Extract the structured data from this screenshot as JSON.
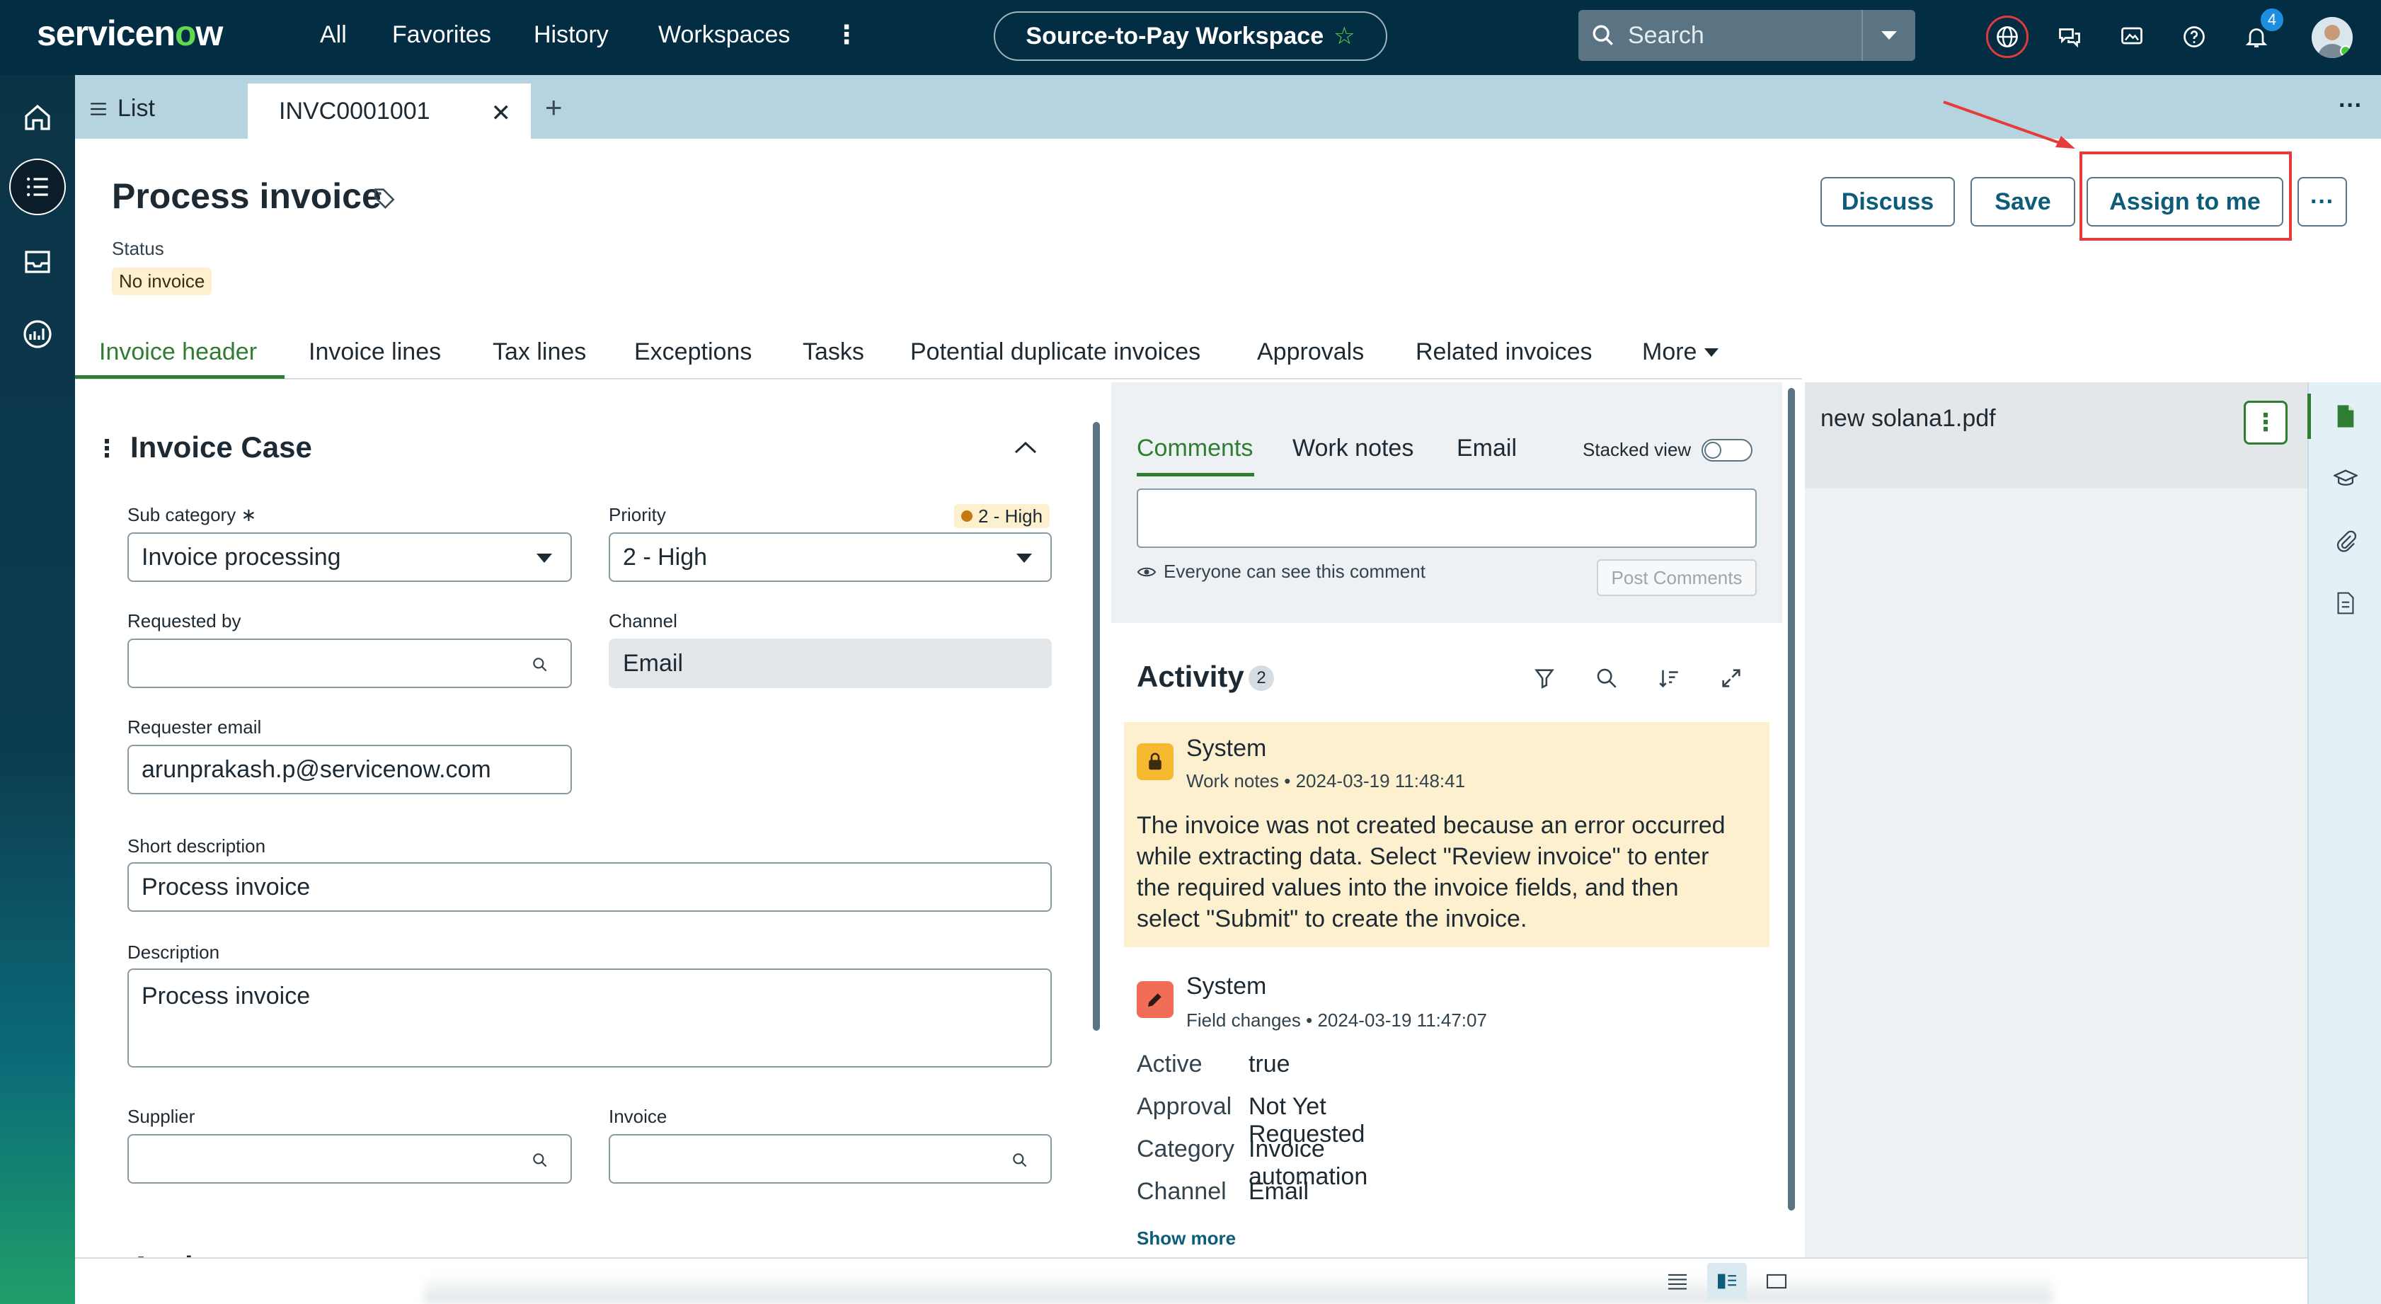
{
  "topnav": {
    "logo": "servicenow",
    "links": [
      "All",
      "Favorites",
      "History",
      "Workspaces"
    ],
    "workspace_name": "Source-to-Pay Workspace",
    "search_placeholder": "Search",
    "notification_count": "4"
  },
  "tabs": {
    "list_label": "List",
    "record_tab_label": "INVC0001001"
  },
  "header": {
    "title": "Process invoice",
    "status_label": "Status",
    "status_value": "No invoice",
    "buttons": {
      "discuss": "Discuss",
      "save": "Save",
      "assign_to_me": "Assign to me",
      "more": "···"
    },
    "highlight_color": "#e63b3b"
  },
  "record_tabs": [
    "Invoice header",
    "Invoice lines",
    "Tax lines",
    "Exceptions",
    "Tasks",
    "Potential duplicate invoices",
    "Approvals",
    "Related invoices",
    "More"
  ],
  "form": {
    "section_title": "Invoice Case",
    "sub_category": {
      "label": "Sub category",
      "required_mark": "∗",
      "value": "Invoice processing"
    },
    "priority": {
      "label": "Priority",
      "chip": "2 - High",
      "value": "2 - High"
    },
    "requested_by": {
      "label": "Requested by",
      "value": ""
    },
    "channel": {
      "label": "Channel",
      "value": "Email"
    },
    "requester_email": {
      "label": "Requester email",
      "value": "arunprakash.p@servicenow.com"
    },
    "short_description": {
      "label": "Short description",
      "value": "Process invoice"
    },
    "description": {
      "label": "Description",
      "value": "Process invoice"
    },
    "supplier": {
      "label": "Supplier",
      "value": ""
    },
    "invoice": {
      "label": "Invoice",
      "value": ""
    },
    "next_section_partial": "Assignment"
  },
  "activity": {
    "tabs": [
      "Comments",
      "Work notes",
      "Email"
    ],
    "stacked_view_label": "Stacked view",
    "visibility_note": "Everyone can see this comment",
    "post_button": "Post Comments",
    "title": "Activity",
    "count": "2",
    "entries": [
      {
        "author": "System",
        "type": "Work notes",
        "timestamp": "2024-03-19 11:48:41",
        "lines": [
          "The invoice was not created because an error occurred",
          "while extracting data. Select \"Review invoice\" to enter",
          "the required values into the invoice fields, and then",
          "select \"Submit\" to create the invoice."
        ]
      },
      {
        "author": "System",
        "type": "Field changes",
        "timestamp": "2024-03-19 11:47:07",
        "changes": [
          {
            "key": "Active",
            "value": "true"
          },
          {
            "key": "Approval",
            "value": "Not Yet Requested"
          },
          {
            "key": "Category",
            "value": "Invoice automation"
          },
          {
            "key": "Channel",
            "value": "Email"
          }
        ]
      }
    ],
    "show_more": "Show more"
  },
  "attachment": {
    "filename": "new solana1.pdf"
  }
}
